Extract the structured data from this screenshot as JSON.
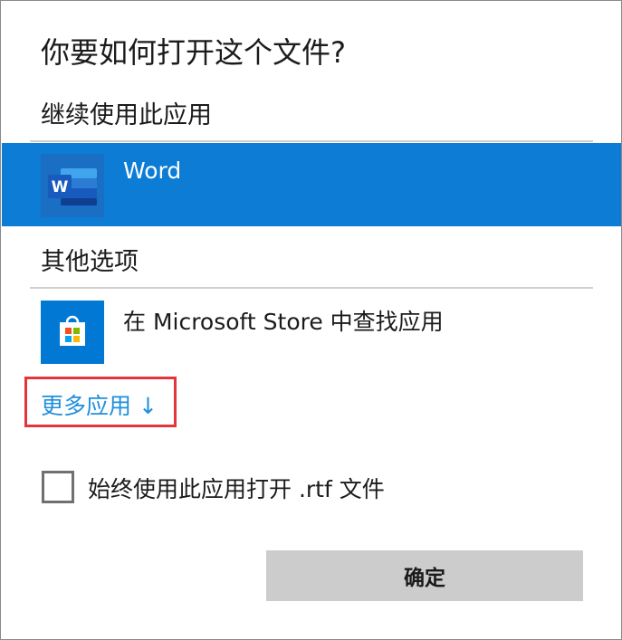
{
  "dialog": {
    "title": "你要如何打开这个文件?",
    "continue_section_label": "继续使用此应用",
    "other_section_label": "其他选项",
    "selected_app": {
      "name": "Word",
      "icon": "word-icon",
      "tile_letter": "W"
    },
    "store_option": {
      "label": "在 Microsoft Store 中查找应用",
      "icon": "microsoft-store-icon"
    },
    "more_apps": {
      "label": "更多应用 ↓"
    },
    "always_use": {
      "label": "始终使用此应用打开 .rtf 文件",
      "checked": false
    },
    "ok_button": {
      "label": "确定"
    }
  },
  "colors": {
    "selection": "#0c7cd5",
    "link": "#1e8fdd",
    "highlight_border": "#e5353b",
    "button_bg": "#cccccc"
  }
}
